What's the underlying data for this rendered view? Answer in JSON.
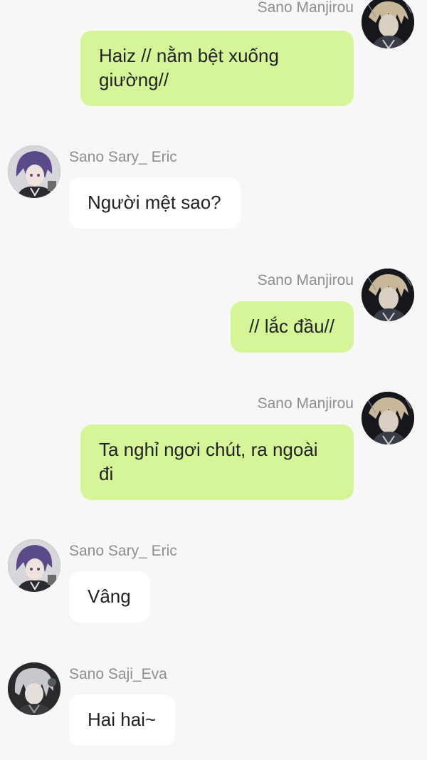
{
  "colors": {
    "background": "#f7f7f7",
    "outgoing_bubble": "#d6f599",
    "incoming_bubble": "#ffffff",
    "sender_name": "#8e8e8e",
    "message_text": "#222222"
  },
  "messages": [
    {
      "side": "right",
      "sender": "Sano Manjirou",
      "avatar": "manjirou-avatar",
      "text": "Haiz // nằm bệt xuống giường//"
    },
    {
      "side": "left",
      "sender": "Sano Sary_ Eric",
      "avatar": "eric-avatar",
      "text": "Người mệt sao?"
    },
    {
      "side": "right",
      "sender": "Sano Manjirou",
      "avatar": "manjirou-avatar",
      "text": "// lắc đầu//"
    },
    {
      "side": "right",
      "sender": "Sano Manjirou",
      "avatar": "manjirou-avatar",
      "text": "Ta nghỉ ngơi chút, ra ngoài đi"
    },
    {
      "side": "left",
      "sender": "Sano Sary_ Eric",
      "avatar": "eric-avatar",
      "text": "Vâng"
    },
    {
      "side": "left",
      "sender": "Sano Saji_Eva",
      "avatar": "eva-avatar",
      "text": "Hai hai~"
    }
  ]
}
